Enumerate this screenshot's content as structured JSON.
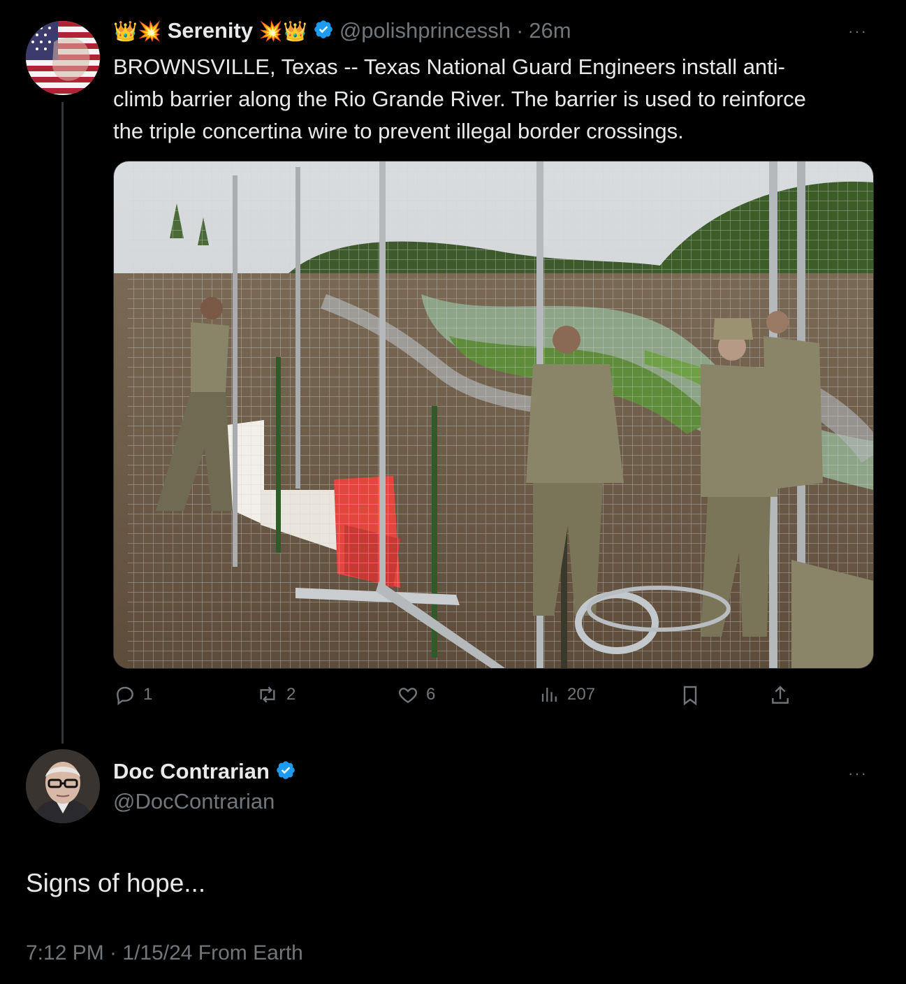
{
  "tweet": {
    "name_emoji_left": "👑💥",
    "display_name": "Serenity",
    "name_emoji_right": "💥👑",
    "handle": "@polishprincessh",
    "separator": "·",
    "time_ago": "26m",
    "text_lines": [
      "BROWNSVILLE, Texas -- Texas National Guard Engineers install anti-",
      "climb barrier along the Rio Grande River. The barrier is used to reinforce",
      "the triple concertina wire to prevent illegal border crossings."
    ],
    "more_label": "···",
    "actions": {
      "replies": "1",
      "reposts": "2",
      "likes": "6",
      "views": "207"
    },
    "avatar_icon": "us-flag-avatar",
    "media_icon": "border-fence-photo"
  },
  "reply": {
    "display_name": "Doc Contrarian",
    "handle": "@DocContrarian",
    "more_label": "···",
    "text": "Signs of hope...",
    "timestamp": "7:12 PM · 1/15/24 From Earth",
    "avatar_icon": "elderly-man-avatar"
  },
  "colors": {
    "background": "#000000",
    "text": "#e7e9ea",
    "muted": "#71767b",
    "verified": "#1d9bf0",
    "thread_line": "#333639"
  }
}
